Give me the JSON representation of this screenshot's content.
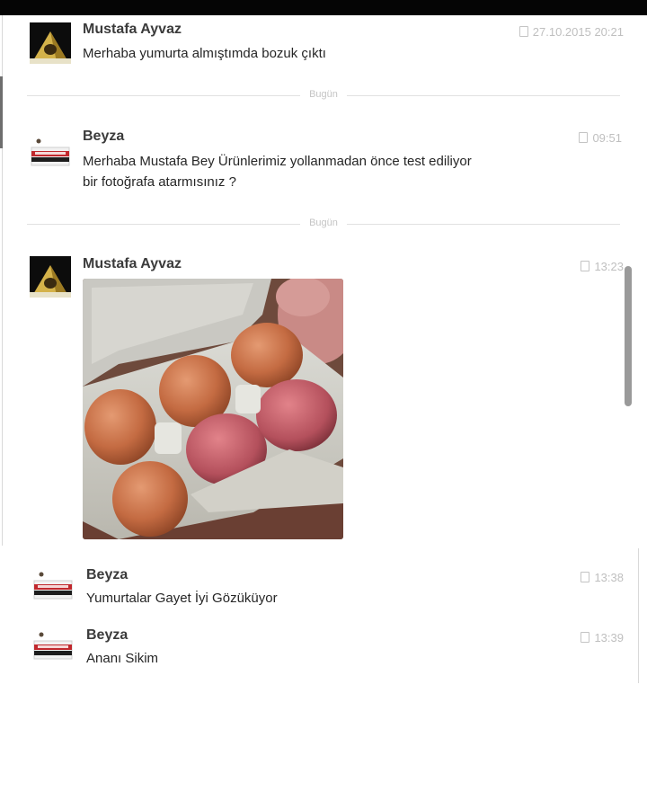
{
  "chat": {
    "messages": [
      {
        "author": "Mustafa Ayvaz",
        "text": "Merhaba yumurta almıştımda bozuk çıktı",
        "time": "27.10.2015 20:21"
      },
      {
        "author": "Beyza",
        "text_lines": [
          "Merhaba Mustafa Bey Ürünlerimiz yollanmadan önce test ediliyor",
          "bir fotoğrafa atarmısınız ?"
        ],
        "time": "09:51"
      },
      {
        "author": "Mustafa Ayvaz",
        "time": "13:23"
      },
      {
        "author": "Beyza",
        "text": "Yumurtalar Gayet İyi Gözüküyor",
        "time": "13:38"
      },
      {
        "author": "Beyza",
        "text": "Ananı Sikim",
        "time": "13:39"
      }
    ],
    "dividers": [
      "Bugün",
      "Bugün"
    ]
  },
  "colors": {
    "top_bar": "#050505",
    "divider_line": "#e1e1e1",
    "timestamp": "#bfbfbf",
    "name": "#3b3b3b"
  }
}
